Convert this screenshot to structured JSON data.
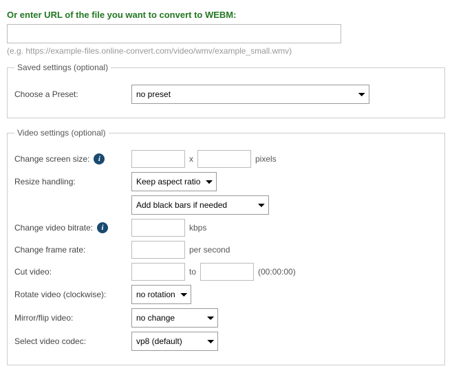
{
  "url_section": {
    "title": "Or enter URL of the file you want to convert to WEBM:",
    "value": "",
    "hint": "(e.g. https://example-files.online-convert.com/video/wmv/example_small.wmv)"
  },
  "saved_settings": {
    "legend": "Saved settings (optional)",
    "preset_label": "Choose a Preset:",
    "preset_value": "no preset"
  },
  "video_settings": {
    "legend": "Video settings (optional)",
    "screen_size_label": "Change screen size:",
    "screen_w": "",
    "screen_h": "",
    "x_sep": "x",
    "pixels_label": "pixels",
    "resize_label": "Resize handling:",
    "resize_mode": "Keep aspect ratio",
    "resize_bars": "Add black bars if needed",
    "bitrate_label": "Change video bitrate:",
    "bitrate_value": "",
    "bitrate_unit": "kbps",
    "framerate_label": "Change frame rate:",
    "framerate_value": "",
    "framerate_unit": "per second",
    "cut_label": "Cut video:",
    "cut_from": "",
    "cut_to_sep": "to",
    "cut_to": "",
    "cut_hint": "(00:00:00)",
    "rotate_label": "Rotate video (clockwise):",
    "rotate_value": "no rotation",
    "mirror_label": "Mirror/flip video:",
    "mirror_value": "no change",
    "codec_label": "Select video codec:",
    "codec_value": "vp8 (default)"
  },
  "info_glyph": "i"
}
